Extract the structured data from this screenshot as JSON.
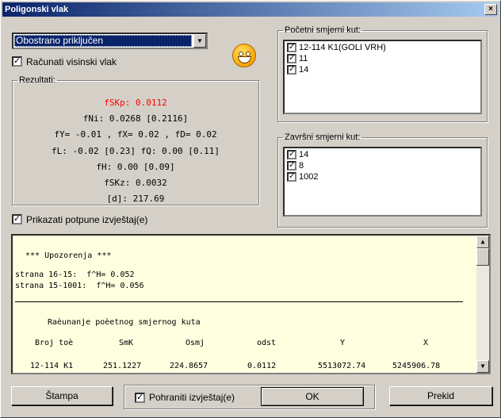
{
  "window": {
    "title": "Poligonski vlak",
    "close_glyph": "×"
  },
  "mode_select": {
    "value": "Obostrano priključen",
    "arrow": "▼"
  },
  "height_check": {
    "label": "Računati visinski vlak",
    "checked": true
  },
  "results": {
    "legend": "Rezultati:",
    "lines": [
      "fSKp: 0.0112",
      "fNi: 0.0268 [0.2116]",
      "fY= -0.01 , fX= 0.02 , fD= 0.02",
      "fL: -0.02 [0.23]      fQ: 0.00 [0.11]",
      "fH: 0.00 [0.09]",
      "fSKz: 0.0032",
      "[d]: 217.69"
    ],
    "highlight_color": "#ff0000"
  },
  "full_report_check": {
    "label": "Prikazati potpune izvještaj(e)",
    "checked": true
  },
  "start_angles": {
    "legend": "Početni smjerni kut:",
    "items": [
      "12-114 K1(GOLI VRH)",
      "11",
      "14"
    ]
  },
  "end_angles": {
    "legend": "Završni smjerni kut:",
    "items": [
      "14",
      "8",
      "1002"
    ]
  },
  "report": {
    "warning_title": "*** Upozorenja ***",
    "warnings": [
      "strana 16-15:  f^H= 0.052",
      "strana 15-1001:  f^H= 0.056"
    ],
    "section_title": "Raèunanje poèetnog smjernog kuta",
    "headers": [
      "Broj toè",
      "SmK",
      "Osmj",
      "odst",
      "Y",
      "X"
    ],
    "rows": [
      [
        "12-114 K1",
        "251.1227",
        "224.8657",
        "0.0112",
        "5513072.74",
        "5245906.78"
      ]
    ]
  },
  "footer": {
    "print_label": "Štampa",
    "save_label": "Pohraniti izvještaj(e)",
    "save_checked": true,
    "ok_label": "OK",
    "cancel_label": "Prekid"
  },
  "check_glyph": "✓",
  "scroll": {
    "up": "▲",
    "down": "▼"
  }
}
